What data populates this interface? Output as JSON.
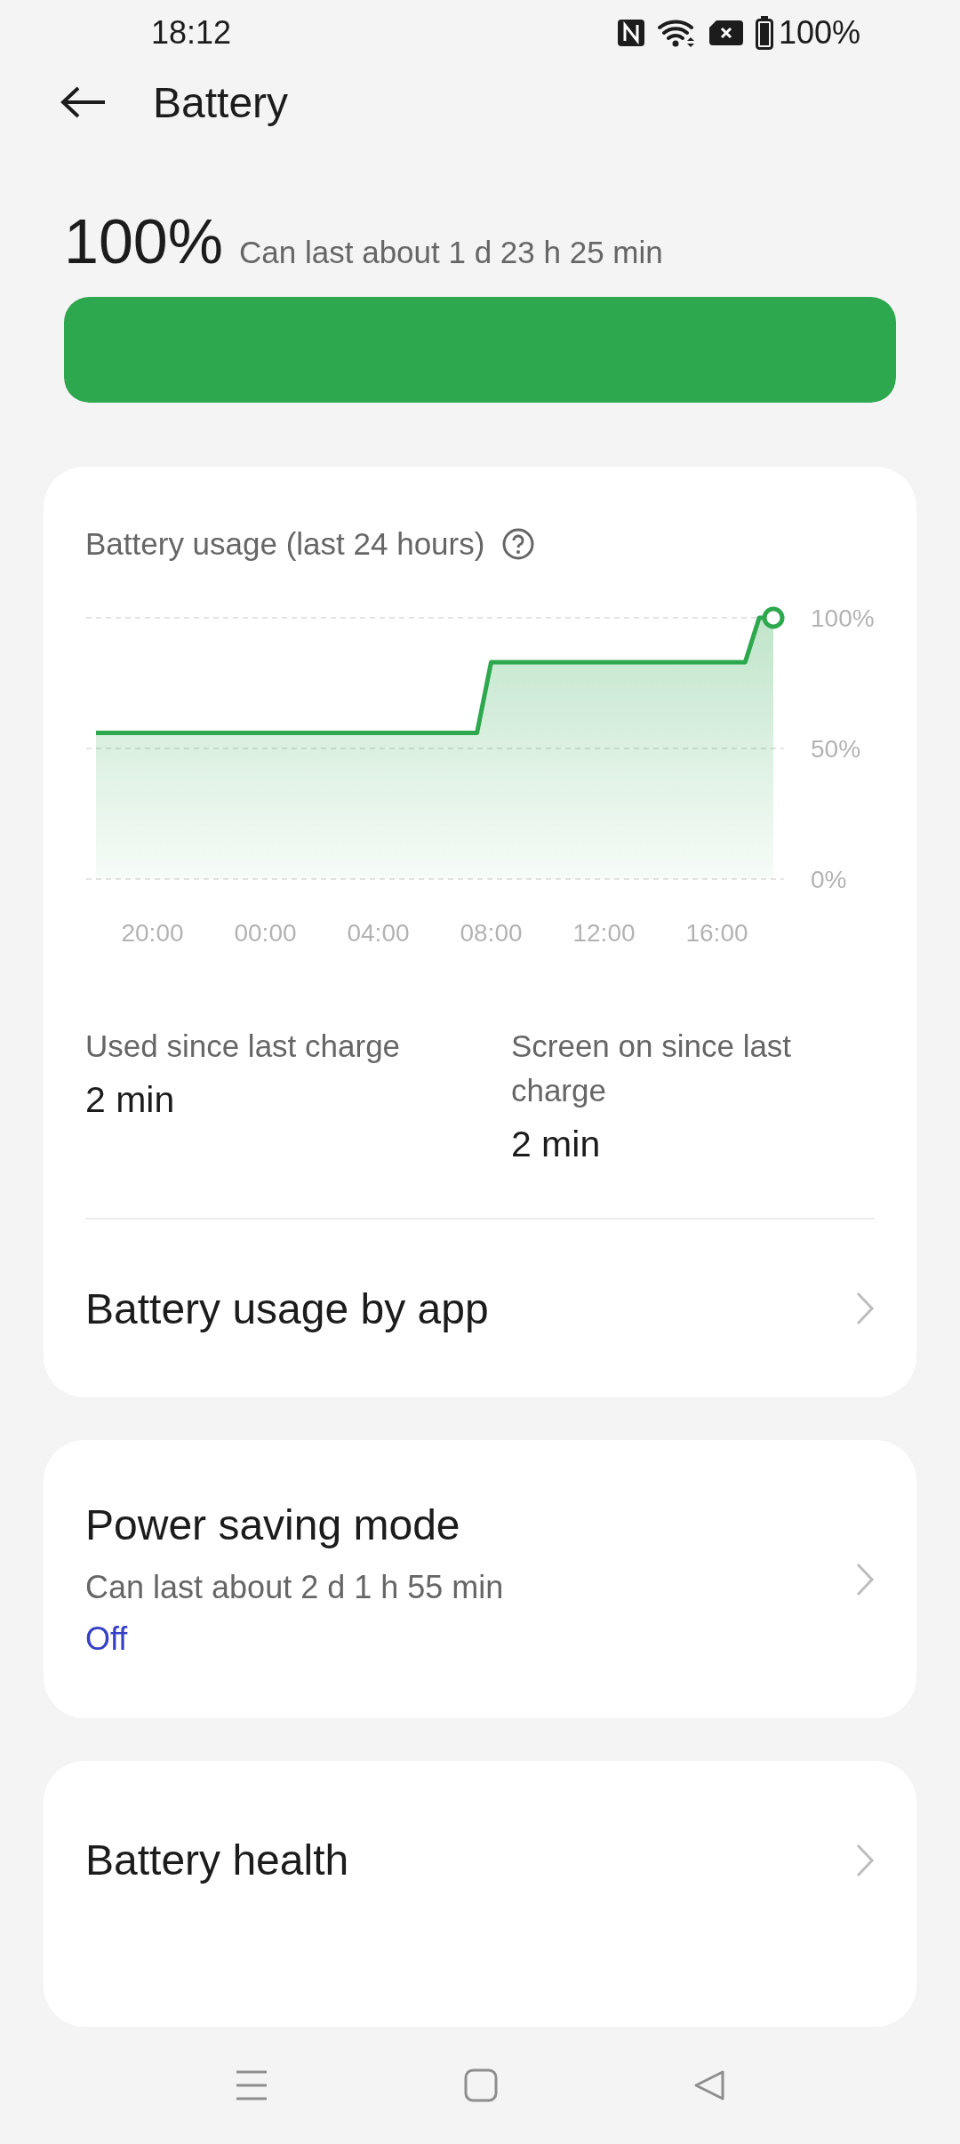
{
  "status_bar": {
    "time": "18:12",
    "battery_percent": "100%"
  },
  "header": {
    "title": "Battery"
  },
  "summary": {
    "percent": "100%",
    "estimate": "Can last about 1 d 23 h 25 min",
    "level": 1
  },
  "usage_card": {
    "title": "Battery usage (last 24 hours)",
    "chart_data": {
      "type": "area",
      "categories": [
        null,
        null,
        null,
        null,
        "20:00",
        null,
        null,
        null,
        null,
        null,
        null,
        null,
        "00:00",
        null,
        null,
        null,
        null,
        null,
        null,
        null,
        "04:00",
        null,
        null,
        null,
        null,
        null,
        null,
        null,
        "08:00",
        null,
        null,
        null,
        null,
        null,
        null,
        null,
        "12:00",
        null,
        null,
        null,
        null,
        null,
        null,
        null,
        "16:00",
        null,
        null,
        null,
        null
      ],
      "series": [
        {
          "color": "#2ea84e",
          "values": [
            56,
            56,
            56,
            56,
            56,
            56,
            56,
            56,
            56,
            56,
            56,
            56,
            56,
            56,
            56,
            56,
            56,
            56,
            56,
            56,
            56,
            56,
            56,
            56,
            56,
            56,
            56,
            56,
            83,
            83,
            83,
            83,
            83,
            83,
            83,
            83,
            83,
            83,
            83,
            83,
            83,
            83,
            83,
            83,
            83,
            83,
            83,
            100,
            100
          ]
        }
      ],
      "ylim": [
        0,
        100
      ],
      "yticks": [
        {
          "value": 100,
          "label": "100%"
        },
        {
          "value": 50,
          "label": "50%"
        },
        {
          "value": 0,
          "label": "0%"
        }
      ]
    },
    "stats": [
      {
        "label": "Used since last charge",
        "value": "2 min"
      },
      {
        "label": "Screen on since last charge",
        "value": "2 min"
      }
    ],
    "link": "Battery usage by app"
  },
  "settings": [
    {
      "title": "Power saving mode",
      "subtitle": "Can last about 2 d 1 h 55 min",
      "status": "Off"
    },
    {
      "title": "Battery health"
    }
  ]
}
